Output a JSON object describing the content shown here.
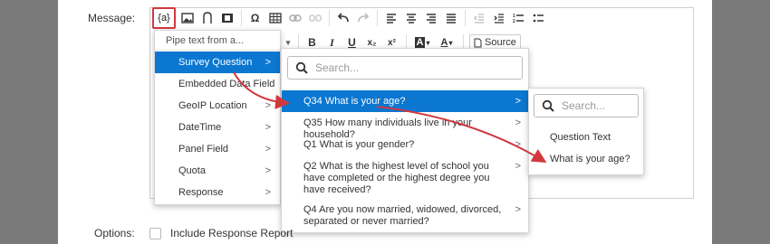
{
  "form": {
    "message_label": "Message:",
    "options_label": "Options:",
    "include_response_report": "Include Response Report"
  },
  "toolbar": {
    "pipe_text": "{a}",
    "omega": "Ω",
    "bold": "B",
    "italic": "I",
    "underline": "U",
    "subscript": "x₂",
    "superscript": "x²",
    "text_color": "A",
    "bg_color": "A",
    "source": "Source"
  },
  "pipe_menu": {
    "header": "Pipe text from a...",
    "items": [
      {
        "label": "Survey Question",
        "chevron": ">"
      },
      {
        "label": "Embedded Data Field",
        "chevron": ""
      },
      {
        "label": "GeoIP Location",
        "chevron": ">"
      },
      {
        "label": "DateTime",
        "chevron": ">"
      },
      {
        "label": "Panel Field",
        "chevron": ">"
      },
      {
        "label": "Quota",
        "chevron": ">"
      },
      {
        "label": "Response",
        "chevron": ">"
      }
    ]
  },
  "question_menu": {
    "search_placeholder": "Search...",
    "items": [
      {
        "label": "Q34 What is your age?",
        "chevron": ">"
      },
      {
        "label": "Q35 How many individuals live in your household?",
        "chevron": ">"
      },
      {
        "label": "Q1 What is your gender?",
        "chevron": ">"
      },
      {
        "label": "Q2 What is the highest level of school you have completed or the highest degree you have received?",
        "chevron": ">"
      },
      {
        "label": "Q4 Are you now married, widowed, divorced, separated or never married?",
        "chevron": ">"
      }
    ]
  },
  "field_menu": {
    "search_placeholder": "Search...",
    "items": [
      {
        "label": "Question Text"
      },
      {
        "label": "What is your age?"
      }
    ]
  },
  "colors": {
    "accent_blue": "#0b77d1",
    "highlight_red": "#d1383e",
    "backdrop": "#7a7a7a"
  }
}
